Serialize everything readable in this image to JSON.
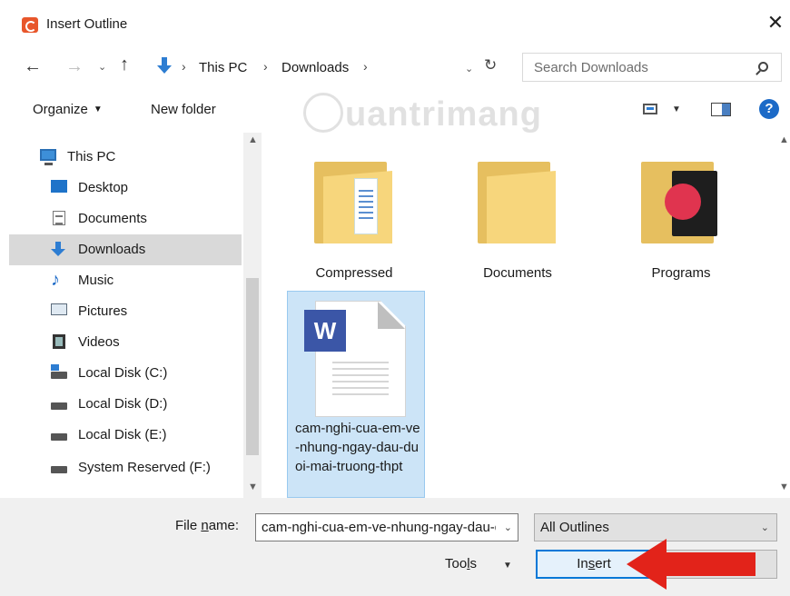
{
  "window": {
    "title": "Insert Outline",
    "close_glyph": "✕"
  },
  "nav": {
    "back": "←",
    "forward": "→",
    "recent": "⌄",
    "up": "↑",
    "breadcrumb": [
      "This PC",
      "Downloads"
    ],
    "sep": "›",
    "refresh": "↻",
    "dropdown": "⌄",
    "search_placeholder": "Search Downloads"
  },
  "toolbar": {
    "organize": "Organize",
    "new_folder": "New folder",
    "watermark": "uantrimang",
    "help": "?"
  },
  "sidebar": {
    "items": [
      {
        "label": "This PC",
        "icon": "computer-icon"
      },
      {
        "label": "Desktop",
        "icon": "desktop-icon"
      },
      {
        "label": "Documents",
        "icon": "documents-icon"
      },
      {
        "label": "Downloads",
        "icon": "downloads-icon",
        "selected": true
      },
      {
        "label": "Music",
        "icon": "music-icon"
      },
      {
        "label": "Pictures",
        "icon": "pictures-icon"
      },
      {
        "label": "Videos",
        "icon": "videos-icon"
      },
      {
        "label": "Local Disk (C:)",
        "icon": "system-drive-icon"
      },
      {
        "label": "Local Disk (D:)",
        "icon": "drive-icon"
      },
      {
        "label": "Local Disk (E:)",
        "icon": "drive-icon"
      },
      {
        "label": "System Reserved (F:)",
        "icon": "drive-icon"
      }
    ]
  },
  "files": {
    "folders": [
      {
        "label": "Compressed",
        "icon": "folder-compressed-icon"
      },
      {
        "label": "Documents",
        "icon": "folder-icon"
      },
      {
        "label": "Programs",
        "icon": "folder-programs-icon"
      }
    ],
    "selected_file": {
      "label": "cam-nghi-cua-em-ve-nhung-ngay-dau-duoi-mai-truong-thpt",
      "badge": "W",
      "icon": "word-document-icon"
    }
  },
  "bottom": {
    "file_name_label_pre": "File ",
    "file_name_label_ul": "n",
    "file_name_label_post": "ame:",
    "file_name_value": "cam-nghi-cua-em-ve-nhung-ngay-dau-duoi-mai-truong-thpt",
    "filter_value": "All Outlines",
    "tools_pre": "Too",
    "tools_ul": "l",
    "tools_post": "s",
    "insert_pre": "In",
    "insert_ul": "s",
    "insert_post": "ert",
    "dropdown": "⌄",
    "tools_caret": "▼"
  },
  "colors": {
    "accent": "#0078d7",
    "selection": "#cce4f7",
    "arrow": "#e2231a"
  }
}
